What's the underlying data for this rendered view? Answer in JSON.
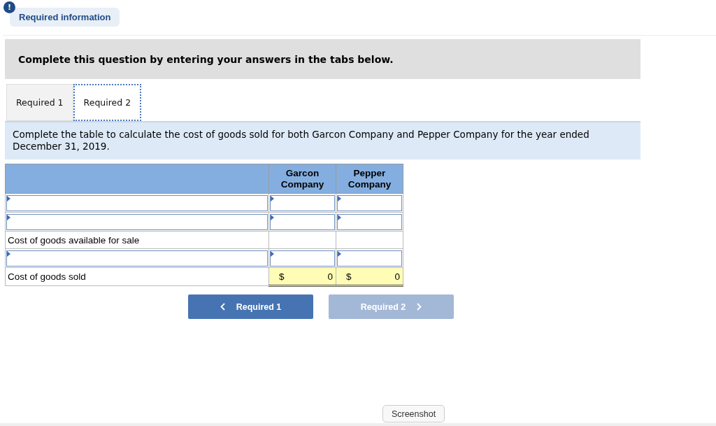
{
  "notice": {
    "icon": "!",
    "label": "Required information"
  },
  "instruction": "Complete this question by entering your answers in the tabs below.",
  "tabs": [
    {
      "label": "Required 1",
      "selected": false
    },
    {
      "label": "Required 2",
      "selected": true
    }
  ],
  "question": "Complete the table to calculate the cost of goods sold for both Garcon Company and Pepper Company for the year ended December 31, 2019.",
  "table": {
    "columns": [
      "Garcon Company",
      "Pepper Company"
    ],
    "rows": [
      {
        "kind": "input"
      },
      {
        "kind": "input"
      },
      {
        "kind": "label",
        "label": "Cost of goods available for sale"
      },
      {
        "kind": "input"
      },
      {
        "kind": "total",
        "label": "Cost of goods sold",
        "cells": [
          {
            "currency": "$",
            "value": "0"
          },
          {
            "currency": "$",
            "value": "0"
          }
        ]
      }
    ]
  },
  "nav": [
    {
      "label": "Required 1",
      "kind": "prev",
      "disabled": false
    },
    {
      "label": "Required 2",
      "kind": "next",
      "disabled": true
    }
  ],
  "tooltip": "Screenshot"
}
